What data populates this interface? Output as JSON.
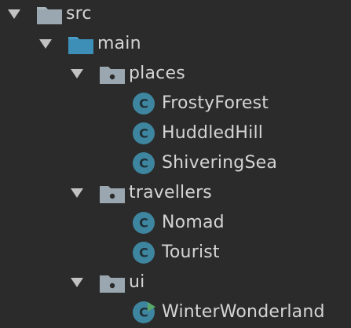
{
  "colors": {
    "background": "#2b2b2b",
    "text": "#d4d4d4",
    "chevron": "#c2c2c2",
    "folder_grey": "#9aa7b0",
    "folder_blue": "#3d8fb8",
    "class_badge": "#3e86a0",
    "runnable_marker": "#59a869"
  },
  "tree": {
    "src": {
      "label": "src",
      "icon": "folder-icon",
      "expanded": true
    },
    "main": {
      "label": "main",
      "icon": "source-folder-icon",
      "expanded": true
    },
    "places": {
      "label": "places",
      "icon": "package-icon",
      "expanded": true,
      "children": [
        {
          "label": "FrostyForest",
          "badge": "C",
          "icon": "class-icon"
        },
        {
          "label": "HuddledHill",
          "badge": "C",
          "icon": "class-icon"
        },
        {
          "label": "ShiveringSea",
          "badge": "C",
          "icon": "class-icon"
        }
      ]
    },
    "travellers": {
      "label": "travellers",
      "icon": "package-icon",
      "expanded": true,
      "children": [
        {
          "label": "Nomad",
          "badge": "C",
          "icon": "class-icon"
        },
        {
          "label": "Tourist",
          "badge": "C",
          "icon": "class-icon"
        }
      ]
    },
    "ui": {
      "label": "ui",
      "icon": "package-icon",
      "expanded": true,
      "children": [
        {
          "label": "WinterWonderland",
          "badge": "C",
          "icon": "runnable-class-icon"
        }
      ]
    }
  }
}
